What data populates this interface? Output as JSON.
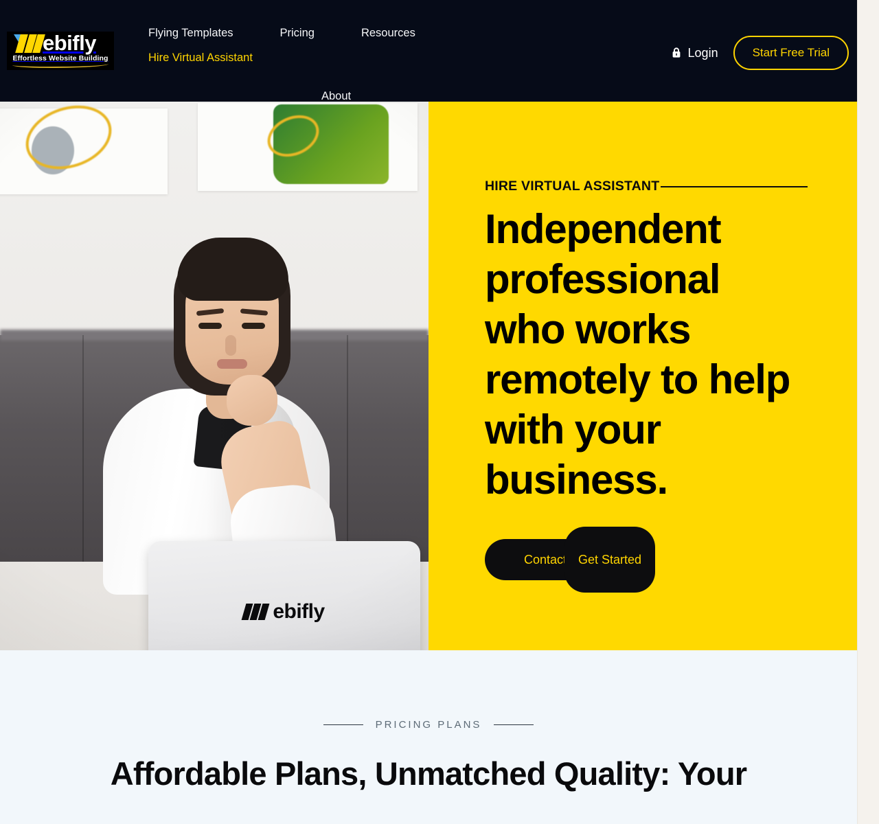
{
  "brand": {
    "name": "Webifly",
    "word_mark": "ebifly",
    "tagline": "Effortless Website Building",
    "logo_icon": "webifly-w-logo"
  },
  "header": {
    "nav": [
      {
        "label": "Flying Templates",
        "active": false
      },
      {
        "label": "Pricing",
        "active": false
      },
      {
        "label": "Resources",
        "active": false
      },
      {
        "label": "Hire Virtual Assistant",
        "active": true
      },
      {
        "label": "About",
        "active": false
      }
    ],
    "login_label": "Login",
    "login_icon": "lock-icon",
    "trial_label": "Start Free Trial",
    "bg_color": "#060b18",
    "accent_color": "#ffd400"
  },
  "hero": {
    "eyebrow": "HIRE VIRTUAL ASSISTANT",
    "headline": "Independent professional who works remotely to help with your business.",
    "buttons": {
      "contact_label": "Contact",
      "get_started_label": "Get Started"
    },
    "panel_color": "#ffd900",
    "image": {
      "alt_description": "Woman in white shirt resting chin on hand, sitting behind a silver laptop on a wooden desk",
      "laptop_logo_text": "ebifly"
    }
  },
  "pricing": {
    "kicker": "PRICING PLANS",
    "title": "Affordable Plans, Unmatched Quality: Your",
    "bg_color": "#f2f7fb"
  }
}
